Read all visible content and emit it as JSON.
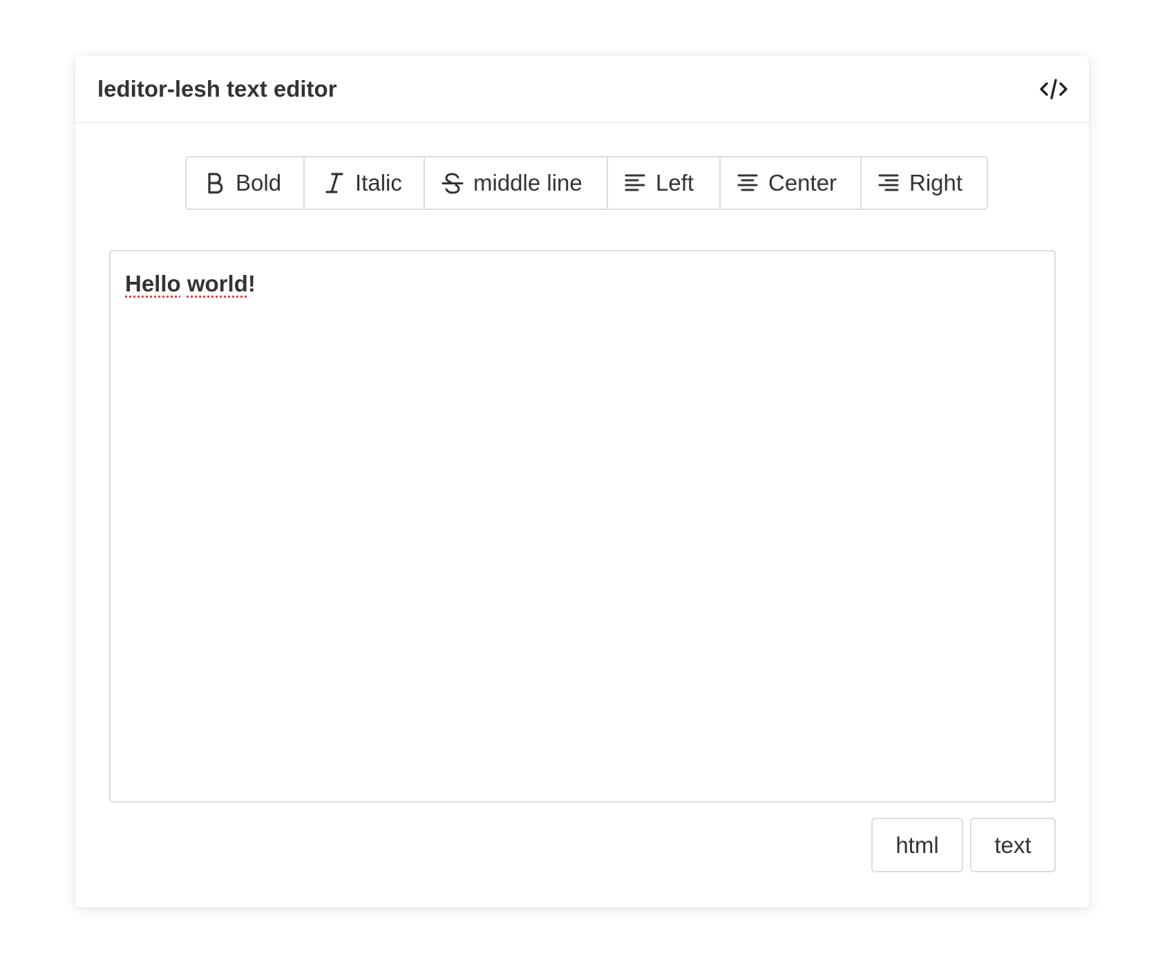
{
  "header": {
    "title": "leditor-lesh text editor",
    "code_toggle_icon": "code-icon"
  },
  "toolbar": {
    "buttons": [
      {
        "label": "Bold",
        "icon": "bold-icon"
      },
      {
        "label": "Italic",
        "icon": "italic-icon"
      },
      {
        "label": "middle line",
        "icon": "strikethrough-icon"
      },
      {
        "label": "Left",
        "icon": "align-left-icon"
      },
      {
        "label": "Center",
        "icon": "align-center-icon"
      },
      {
        "label": "Right",
        "icon": "align-right-icon"
      }
    ]
  },
  "editor": {
    "word1": "Hello",
    "word2": "world",
    "punctuation": "!"
  },
  "footer": {
    "html_label": "html",
    "text_label": "text"
  },
  "colors": {
    "text": "#333333",
    "border": "#dcdcdc",
    "spellcheck": "#e04040"
  }
}
